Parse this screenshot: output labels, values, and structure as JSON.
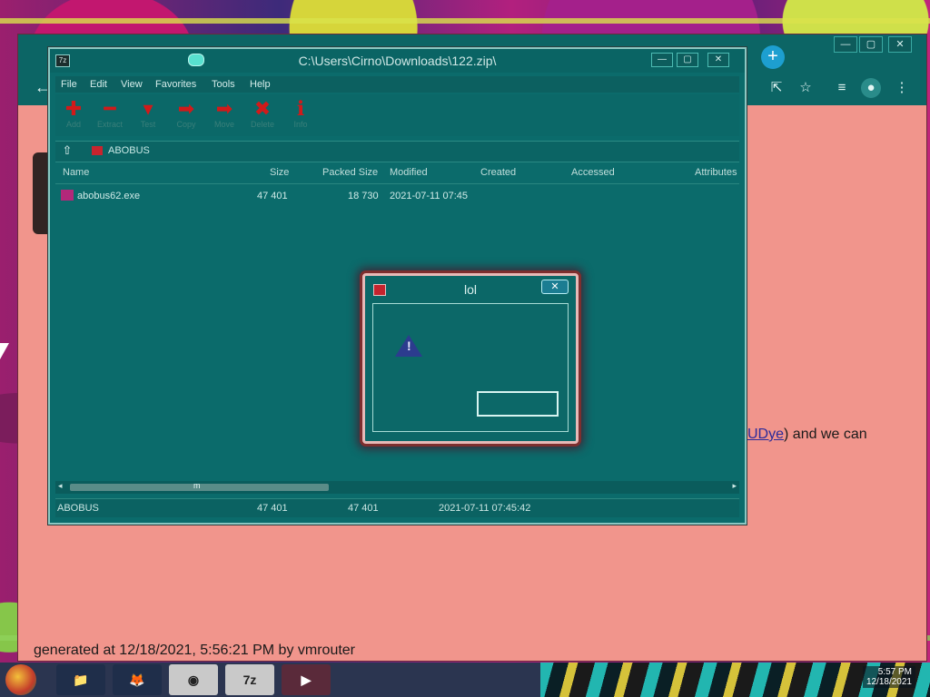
{
  "browser": {
    "controls": [
      "—",
      "▢",
      "✕"
    ],
    "new_tab": "+",
    "tools": [
      "share-icon",
      "star-icon",
      "playlist-icon",
      "profile-icon",
      "menu-icon"
    ],
    "page_text_pre": "",
    "page_link": "xUDye",
    "page_text_post": ") and we can",
    "generated_text": "generated at 12/18/2021, 5:56:21 PM by vmrouter"
  },
  "zip_window": {
    "title": "C:\\Users\\Cirno\\Downloads\\122.zip\\",
    "app_icon": "7z",
    "controls": [
      "—",
      "▢",
      "✕"
    ],
    "menu": [
      "File",
      "Edit",
      "View",
      "Favorites",
      "Tools",
      "Help"
    ],
    "toolbar": [
      {
        "name": "add",
        "label": "Add",
        "icon": "plus-icon"
      },
      {
        "name": "extract",
        "label": "Extract",
        "icon": "minus-icon"
      },
      {
        "name": "test",
        "label": "Test",
        "icon": "check-icon"
      },
      {
        "name": "copy",
        "label": "Copy",
        "icon": "arrow-right-icon"
      },
      {
        "name": "move",
        "label": "Move",
        "icon": "arrow-right-icon"
      },
      {
        "name": "delete",
        "label": "Delete",
        "icon": "x-icon"
      },
      {
        "name": "info",
        "label": "Info",
        "icon": "info-icon"
      }
    ],
    "address": "ABOBUS",
    "columns": [
      "Name",
      "Size",
      "Packed Size",
      "Modified",
      "Created",
      "Accessed",
      "Attributes"
    ],
    "rows": [
      {
        "name": "abobus62.exe",
        "size": "47 401",
        "packed": "18 730",
        "modified": "2021-07-11 07:45",
        "created": "",
        "accessed": ""
      }
    ],
    "scroll_label": "m",
    "status": [
      "ABOBUS",
      "47 401",
      "47 401",
      "2021-07-11 07:45:42"
    ]
  },
  "dialog": {
    "title": "lol",
    "close": "✕",
    "message": "",
    "ok_label": ""
  },
  "taskbar": {
    "apps": [
      {
        "name": "explorer",
        "label": "📁"
      },
      {
        "name": "firefox",
        "label": "🦊"
      },
      {
        "name": "browser",
        "label": "◉"
      },
      {
        "name": "7zip",
        "label": "7z"
      },
      {
        "name": "app",
        "label": "▶"
      }
    ],
    "clock_time": "5:57 PM",
    "clock_date": "12/18/2021"
  }
}
